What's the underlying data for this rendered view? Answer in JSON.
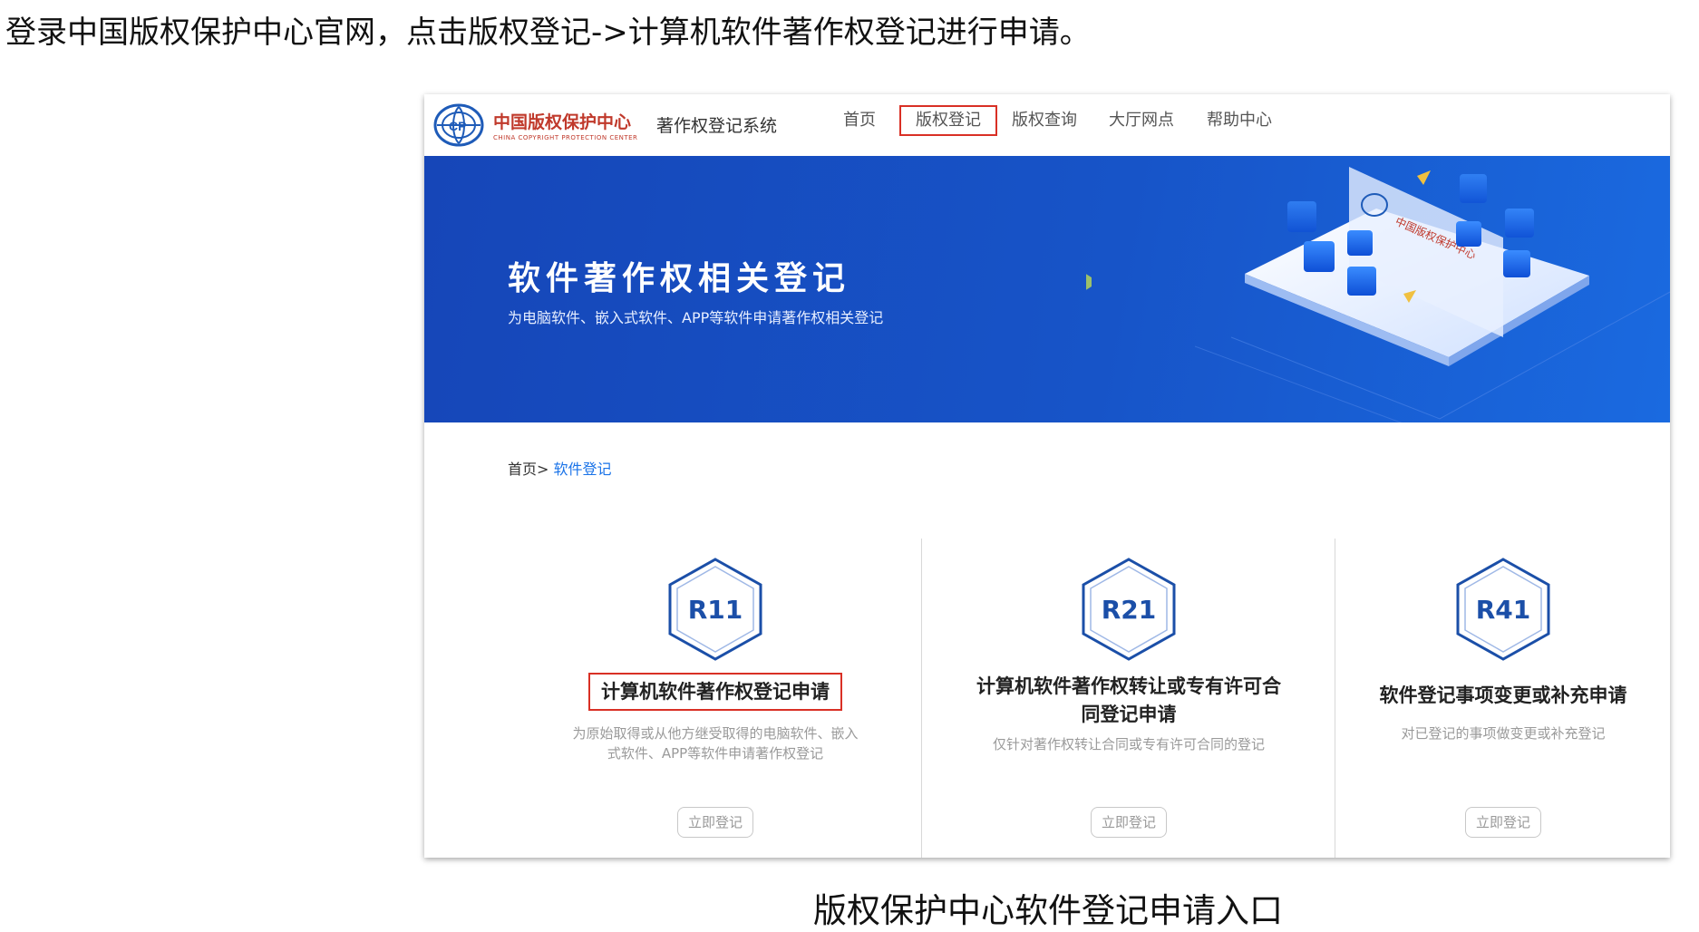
{
  "instruction": "登录中国版权保护中心官网，点击版权登记->计算机软件著作权登记进行申请。",
  "caption": "版权保护中心软件登记申请入口",
  "header": {
    "logo_cn": "中国版权保护中心",
    "logo_en": "CHINA COPYRIGHT PROTECTION CENTER",
    "system_name": "著作权登记系统",
    "nav": [
      "首页",
      "版权登记",
      "版权查询",
      "大厅网点",
      "帮助中心"
    ],
    "active_nav": "版权登记"
  },
  "banner": {
    "title": "软件著作权相关登记",
    "subtitle": "为电脑软件、嵌入式软件、APP等软件申请著作权相关登记",
    "panel_text": "中国版权保护中心"
  },
  "breadcrumb": {
    "home": "首页>",
    "current": "软件登记"
  },
  "cards": [
    {
      "code": "R11",
      "title": "计算机软件著作权登记申请",
      "highlighted": true,
      "desc_lines": [
        "为原始取得或从他方继受取得的电脑软件、嵌入",
        "式软件、APP等软件申请著作权登记"
      ],
      "button": "立即登记"
    },
    {
      "code": "R21",
      "title_lines": [
        "计算机软件著作权转让或专有许可合",
        "同登记申请"
      ],
      "highlighted": false,
      "desc_lines": [
        "仅针对著作权转让合同或专有许可合同的登记"
      ],
      "button": "立即登记"
    },
    {
      "code": "R41",
      "title": "软件登记事项变更或补充申请",
      "highlighted": false,
      "desc_lines": [
        "对已登记的事项做变更或补充登记"
      ],
      "button": "立即登记"
    }
  ],
  "colors": {
    "banner_blue": "#1646b8",
    "highlight_red": "#d93025",
    "link_blue": "#1a73e8",
    "hex_blue": "#1b4fa8"
  }
}
